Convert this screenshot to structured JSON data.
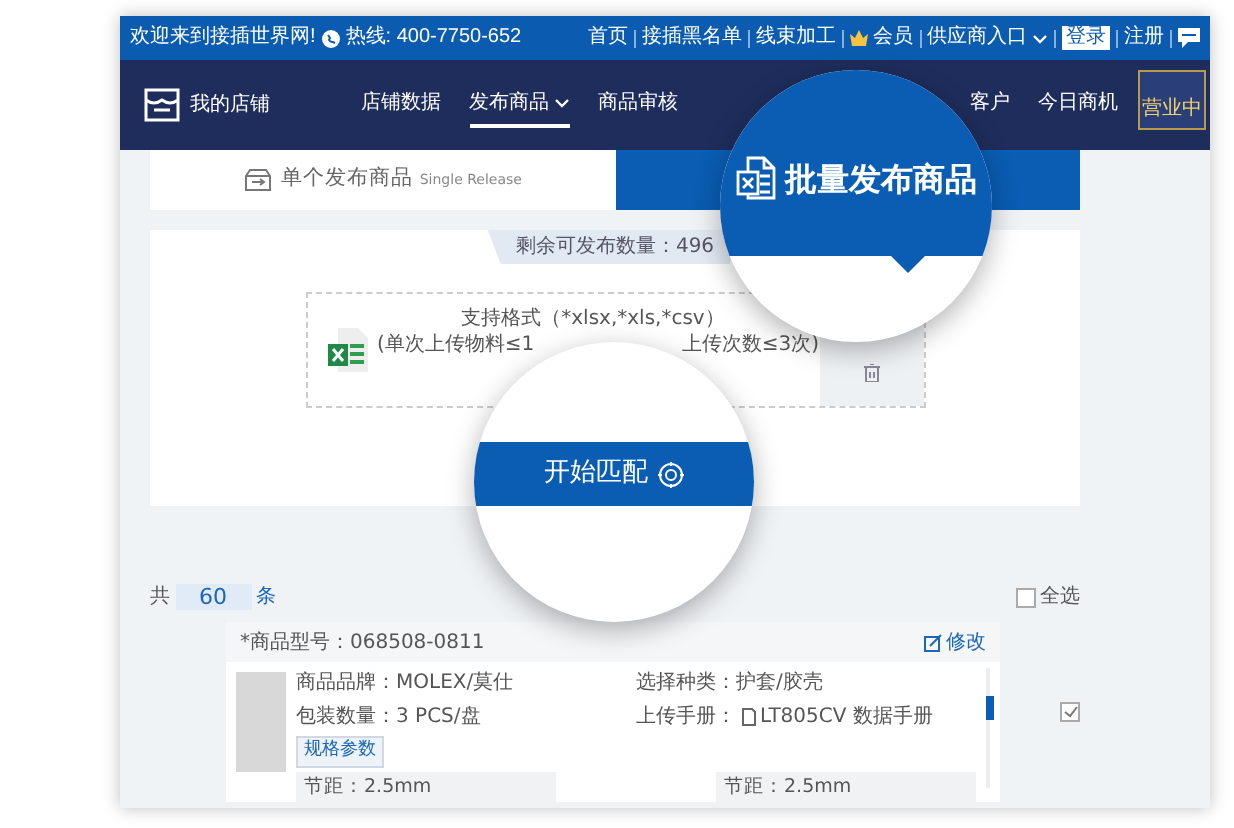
{
  "top_bar": {
    "welcome": "欢迎来到接插世界网!",
    "hotline": "热线: 400-7750-652",
    "links": [
      {
        "label": "首页",
        "kind": "text"
      },
      {
        "label": "接插黑名单",
        "kind": "text"
      },
      {
        "label": "线束加工",
        "kind": "text"
      },
      {
        "label": "会员",
        "kind": "member"
      },
      {
        "label": "供应商入口",
        "kind": "dropdown"
      },
      {
        "label": "登录",
        "kind": "boxed"
      },
      {
        "label": "注册",
        "kind": "text"
      }
    ]
  },
  "navbar": {
    "brand": "我的店铺",
    "items": [
      {
        "label": "店铺数据",
        "selected": false,
        "dropdown": false
      },
      {
        "label": "发布商品",
        "selected": true,
        "dropdown": true
      },
      {
        "label": "商品审核",
        "selected": false,
        "dropdown": false
      },
      {
        "label": "客户",
        "selected": false,
        "dropdown": false
      },
      {
        "label": "今日商机",
        "selected": false,
        "dropdown": false
      }
    ],
    "shop_badge": "营业中"
  },
  "tabs": [
    {
      "label": "单个发布商品",
      "sublabel": "Single Release",
      "selected": false
    },
    {
      "label": "批量发布商品",
      "selected": true
    }
  ],
  "remaining": "剩余可发布数量：496",
  "upload": {
    "formats": "支持格式（*xlsx,*xls,*csv）",
    "limit_left": "(单次上传物料≤1",
    "limit_right": "上传次数≤3次)"
  },
  "match_button": "开始匹配",
  "count": {
    "prefix": "共",
    "value": "60",
    "suffix": "条"
  },
  "select_all": {
    "label": "全选",
    "checked": false
  },
  "product": {
    "model": "*商品型号：068508-0811",
    "edit": "修改",
    "checked": true,
    "fields": [
      {
        "label": "商品品牌：MOLEX/莫仕",
        "kind": "text"
      },
      {
        "label": "选择种类：护套/胶壳",
        "kind": "text"
      },
      {
        "label": "包装数量：3 PCS/盘",
        "kind": "text"
      },
      {
        "label": "上传手册：",
        "link": "LT805CV 数据手册",
        "kind": "file"
      }
    ],
    "spec_tab": "规格参数",
    "specs": [
      "节距：2.5mm",
      "节距：2.5mm"
    ]
  }
}
